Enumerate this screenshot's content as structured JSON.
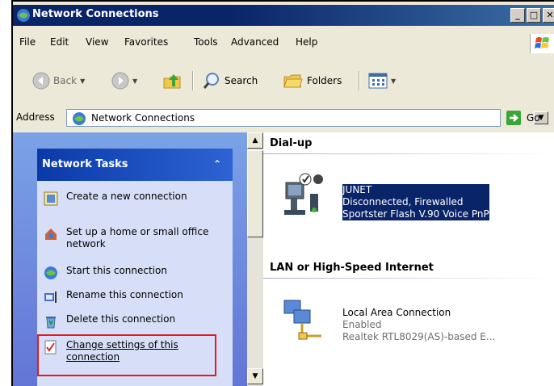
{
  "window": {
    "title": "Network Connections"
  },
  "menu": [
    "File",
    "Edit",
    "View",
    "Favorites",
    "Tools",
    "Advanced",
    "Help"
  ],
  "toolbar": {
    "back": "Back",
    "search": "Search",
    "folders": "Folders"
  },
  "address": {
    "label": "Address",
    "value": "Network Connections",
    "go": "Go"
  },
  "tasks": {
    "heading": "Network Tasks",
    "items": [
      {
        "label": "Create a new connection",
        "icon": "new-connection-icon"
      },
      {
        "label": "Set up a home or small office network",
        "icon": "home-network-icon"
      },
      {
        "label": "Start this connection",
        "icon": "globe-icon"
      },
      {
        "label": "Rename this connection",
        "icon": "rename-icon"
      },
      {
        "label": "Delete this connection",
        "icon": "delete-icon"
      },
      {
        "label": "Change settings of this connection",
        "icon": "checklist-icon"
      }
    ]
  },
  "groups": {
    "dialup": {
      "title": "Dial-up",
      "name": "JUNET",
      "status": "Disconnected, Firewalled",
      "device": "Sportster Flash V.90 Voice PnP"
    },
    "lan": {
      "title": "LAN or High-Speed Internet",
      "name": "Local Area Connection",
      "status": "Enabled",
      "device": "Realtek RTL8029(AS)-based E..."
    }
  },
  "colors": {
    "selection": "#0a246a",
    "highlight": "#e31b1b",
    "title_bar": "#0a246a"
  }
}
